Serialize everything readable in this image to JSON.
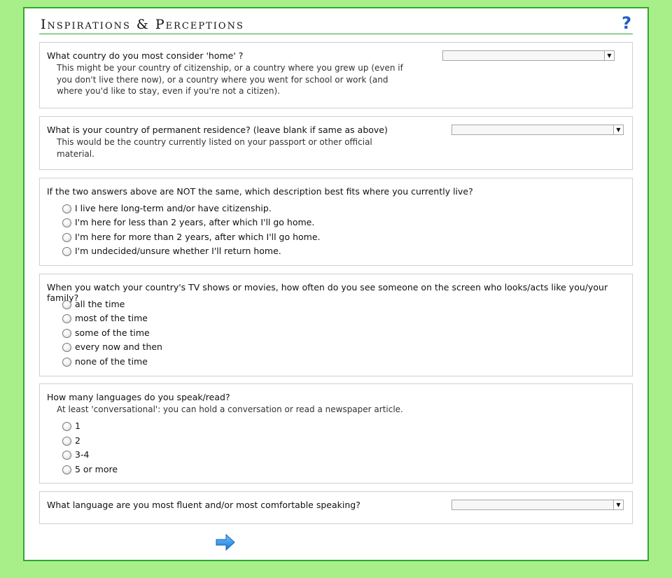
{
  "header": {
    "title": "Inspirations & Perceptions",
    "help_icon": "?"
  },
  "questions": {
    "home_country": {
      "label": "What country do you most consider 'home' ?",
      "note_lines": [
        "This might be your country of citizenship, or a country where you grew up (even if",
        "you don't live there now), or a country where you went for school or work (and",
        "where you'd like to stay, even if you're not a citizen)."
      ],
      "select_value": "",
      "arrow": "▼"
    },
    "residence": {
      "label": "What is your country of permanent residence? (leave blank if same as above)",
      "note_lines": [
        "This would be the country currently listed on your passport or other official",
        "material."
      ],
      "select_value": "",
      "arrow": "▼"
    },
    "living_situation": {
      "label": "If the two answers above are NOT the same, which description best fits where you currently live?",
      "options": [
        "I live here long-term and/or have citizenship.",
        "I'm here for less than 2 years, after which I'll go home.",
        "I'm here for more than 2 years, after which I'll go home.",
        "I'm undecided/unsure whether I'll return home."
      ]
    },
    "tv_representation": {
      "label": "When you watch your country's TV shows or movies, how often do you see someone on the screen who looks/acts like you/your family?",
      "options": [
        "all the time",
        "most of the time",
        "some of the time",
        "every now and then",
        "none of the time"
      ]
    },
    "languages": {
      "label": "How many languages do you speak/read?",
      "note": "At least 'conversational': you can hold a conversation or read a newspaper article.",
      "options": [
        "1",
        "2",
        "3-4",
        "5 or more"
      ]
    },
    "fluent_language": {
      "label": "What language are you most fluent and/or most comfortable speaking?",
      "select_value": "",
      "arrow": "▼"
    }
  },
  "icons": {
    "next": "arrow-right-icon",
    "help": "help-icon"
  },
  "colors": {
    "background": "#a9ef89",
    "border": "#2fa82f",
    "accent": "#1f5fc0"
  }
}
